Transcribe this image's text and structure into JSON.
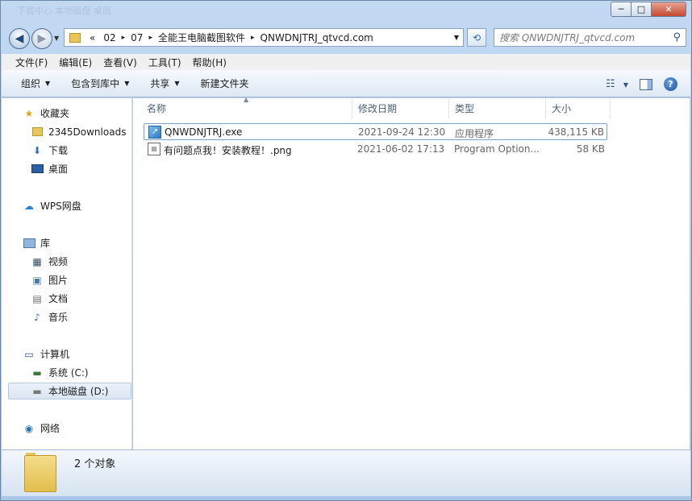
{
  "window": {
    "title_blur": "下载中心   本地磁盘   桌面",
    "minimize": "─",
    "maximize": "□",
    "close": "✕"
  },
  "nav": {
    "back_glyph": "◀",
    "forward_glyph": "▶",
    "history_dropdown": "▼",
    "breadcrumbs": [
      "«",
      "02",
      "07",
      "全能王电脑截图软件",
      "QNWDNJTRJ_qtvcd.com"
    ],
    "crumb_separator": "▸",
    "address_dropdown": "▼",
    "refresh_glyph": "⟲",
    "search_placeholder": "搜索 QNWDNJTRJ_qtvcd.com",
    "search_glyph": "⚲"
  },
  "menubar": [
    "文件(F)",
    "编辑(E)",
    "查看(V)",
    "工具(T)",
    "帮助(H)"
  ],
  "toolbar": {
    "organize": "组织",
    "include_library": "包含到库中",
    "share": "共享",
    "new_folder": "新建文件夹",
    "dropdown_glyph": "▼",
    "view_glyph": "☷"
  },
  "sidebar": {
    "favorites": "收藏夹",
    "favorites_items": [
      "2345Downloads",
      "下载",
      "桌面"
    ],
    "wps": "WPS网盘",
    "libraries": "库",
    "library_items": [
      "视频",
      "图片",
      "文档",
      "音乐"
    ],
    "computer": "计算机",
    "computer_items": [
      "系统 (C:)",
      "本地磁盘 (D:)"
    ],
    "network": "网络"
  },
  "columns": [
    "名称",
    "修改日期",
    "类型",
    "大小"
  ],
  "files": [
    {
      "name": "QNWDNJTRJ.exe",
      "date": "2021-09-24 12:30",
      "type": "应用程序",
      "size": "438,115 KB",
      "icon": "exe-icon"
    },
    {
      "name": "有问题点我！安装教程！.png",
      "date": "2021-06-02 17:13",
      "type": "Program Option...",
      "size": "58 KB",
      "icon": "png-icon"
    }
  ],
  "status": {
    "count": "2 个对象"
  },
  "colors": {
    "accent": "#3f7fc6",
    "selection_border": "#7da2ce",
    "folder": "#e3be4d"
  }
}
